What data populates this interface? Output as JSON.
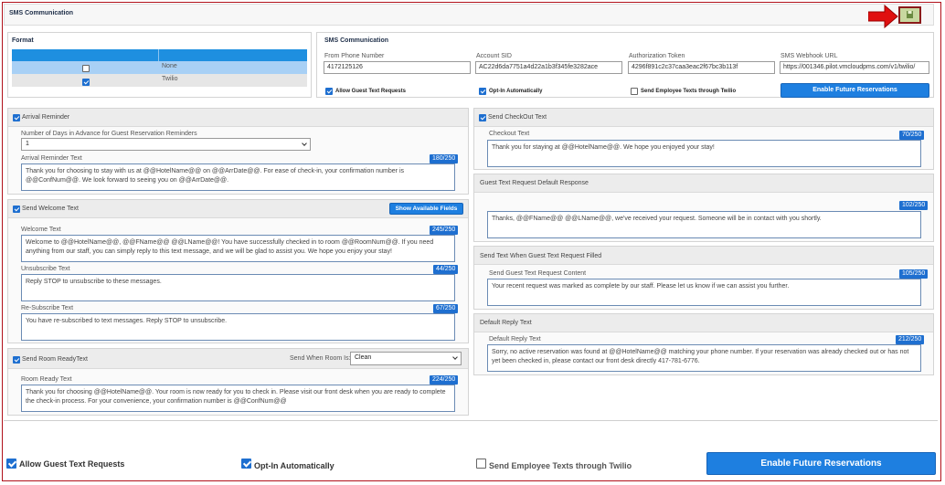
{
  "page": {
    "title": "SMS Communication"
  },
  "colors": {
    "accent": "#1e7fe0",
    "border_frame": "#b0101a",
    "save_button": "#c8d8a0",
    "arrow": "#e01010"
  },
  "format": {
    "title": "Format",
    "options": [
      {
        "label": "None",
        "checked": false
      },
      {
        "label": "Twilio",
        "checked": true
      }
    ]
  },
  "sms": {
    "title": "SMS Communication",
    "from_phone": {
      "label": "From Phone Number",
      "value": "4172125126"
    },
    "account_sid": {
      "label": "Account SID",
      "value": "AC22d6da7751a4d22a1b3f345fe3282ace"
    },
    "auth_token": {
      "label": "Authorization Token",
      "value": "4296f891c2c37caa3eac2f67bc3b113f"
    },
    "webhook_url": {
      "label": "SMS Webhook URL",
      "value": "https://001346.pilot.vmcloudpms.com/v1/twilio/"
    },
    "allow_guest": "Allow Guest Text Requests",
    "opt_in": "Opt-In Automatically",
    "employee_texts": "Send Employee Texts through Twilio",
    "enable_button": "Enable Future Reservations"
  },
  "arrival": {
    "title": "Arrival Reminder",
    "days_label": "Number of Days in Advance for Guest Reservation Reminders",
    "days_value": "1",
    "text_label": "Arrival Reminder Text",
    "count": "180/250",
    "text": "Thank you for choosing to stay with us at @@HotelName@@ on @@ArrDate@@. For ease of check-in, your confirmation number is @@ConfNum@@. We look forward to seeing you on @@ArrDate@@."
  },
  "welcome": {
    "title": "Send Welcome Text",
    "show_fields": "Show Available Fields",
    "welcome_label": "Welcome Text",
    "welcome_count": "245/250",
    "welcome_text": "Welcome to @@HotelName@@, @@FName@@ @@LName@@! You have successfully checked in to room @@RoomNum@@. If you need anything from our staff, you can simply reply to this text message, and we will be glad to assist you. We hope you enjoy your stay!",
    "unsub_label": "Unsubscribe Text",
    "unsub_count": "44/250",
    "unsub_text": "Reply STOP to unsubscribe to these messages.",
    "resub_label": "Re-Subscribe Text",
    "resub_count": "67/250",
    "resub_text": "You have re-subscribed to text messages. Reply STOP to unsubscribe."
  },
  "room_ready": {
    "title": "Send Room ReadyText",
    "when_label": "Send When Room Is:",
    "when_value": "Clean",
    "text_label": "Room Ready Text",
    "count": "224/250",
    "text": "Thank you for choosing @@HotelName@@. Your room is now ready for you to check in. Please visit our front desk when you are ready to complete the check-in process. For your convenience, your confirmation number is @@ConfNum@@"
  },
  "checkout": {
    "title": "Send CheckOut Text",
    "text_label": "Checkout Text",
    "count": "70/250",
    "text": "Thank you for staying at @@HotelName@@. We hope you enjoyed your stay!"
  },
  "guest_default": {
    "title": "Guest Text Request Default Response",
    "count": "102/250",
    "text": "Thanks, @@FName@@ @@LName@@, we've received your request. Someone will be in contact with you shortly."
  },
  "request_filled": {
    "title": "Send Text When Guest Text Request Filled",
    "text_label": "Send Guest Text Request Content",
    "count": "105/250",
    "text": "Your recent request was marked as complete by our staff. Please let us know if we can assist you further."
  },
  "default_reply": {
    "title": "Default Reply Text",
    "text_label": "Default Reply Text",
    "count": "212/250",
    "text": "Sorry, no active reservation was found at @@HotelName@@ matching your phone number. If your reservation was already checked out or has not yet been checked in, please contact our front desk directly 417-781-6776."
  },
  "footer": {
    "allow_guest": "Allow Guest Text Requests",
    "opt_in": "Opt-In Automatically",
    "employee_texts": "Send Employee Texts through Twilio",
    "enable_button": "Enable Future Reservations"
  }
}
